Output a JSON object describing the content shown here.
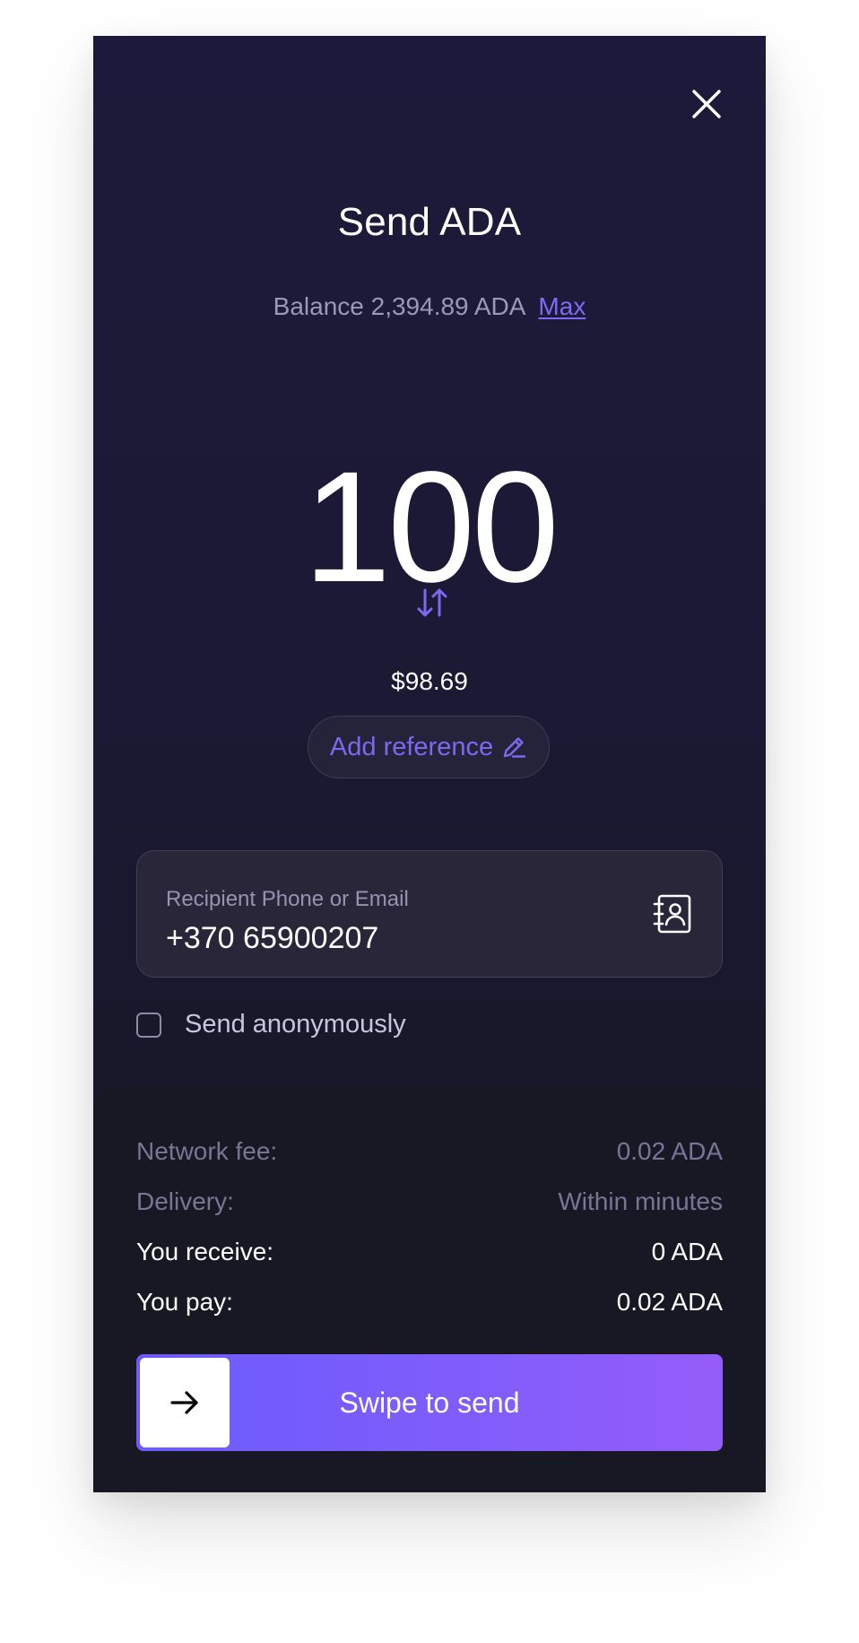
{
  "header": {
    "title": "Send ADA",
    "balance_text": "Balance 2,394.89 ADA",
    "max_label": "Max"
  },
  "amount": {
    "value": "100",
    "fiat_value": "$98.69"
  },
  "reference": {
    "label": "Add reference"
  },
  "recipient": {
    "label": "Recipient Phone or Email",
    "value": "+370 65900207"
  },
  "anonymous": {
    "label": "Send anonymously",
    "checked": false
  },
  "summary": {
    "network_fee_label": "Network fee:",
    "network_fee_value": "0.02 ADA",
    "delivery_label": "Delivery:",
    "delivery_value": "Within minutes",
    "receive_label": "You receive:",
    "receive_value": "0 ADA",
    "pay_label": "You pay:",
    "pay_value": "0.02 ADA"
  },
  "action": {
    "swipe_label": "Swipe to send"
  },
  "icons": {
    "close": "close-icon",
    "swap": "swap-arrows-icon",
    "edit": "pencil-icon",
    "contacts": "contacts-book-icon",
    "arrow": "arrow-right-icon"
  },
  "colors": {
    "accent": "#7c6cf4",
    "background": "#1c1a3a",
    "panel": "#181724",
    "swipe_start": "#6b5cfd",
    "swipe_end": "#955cf9"
  }
}
